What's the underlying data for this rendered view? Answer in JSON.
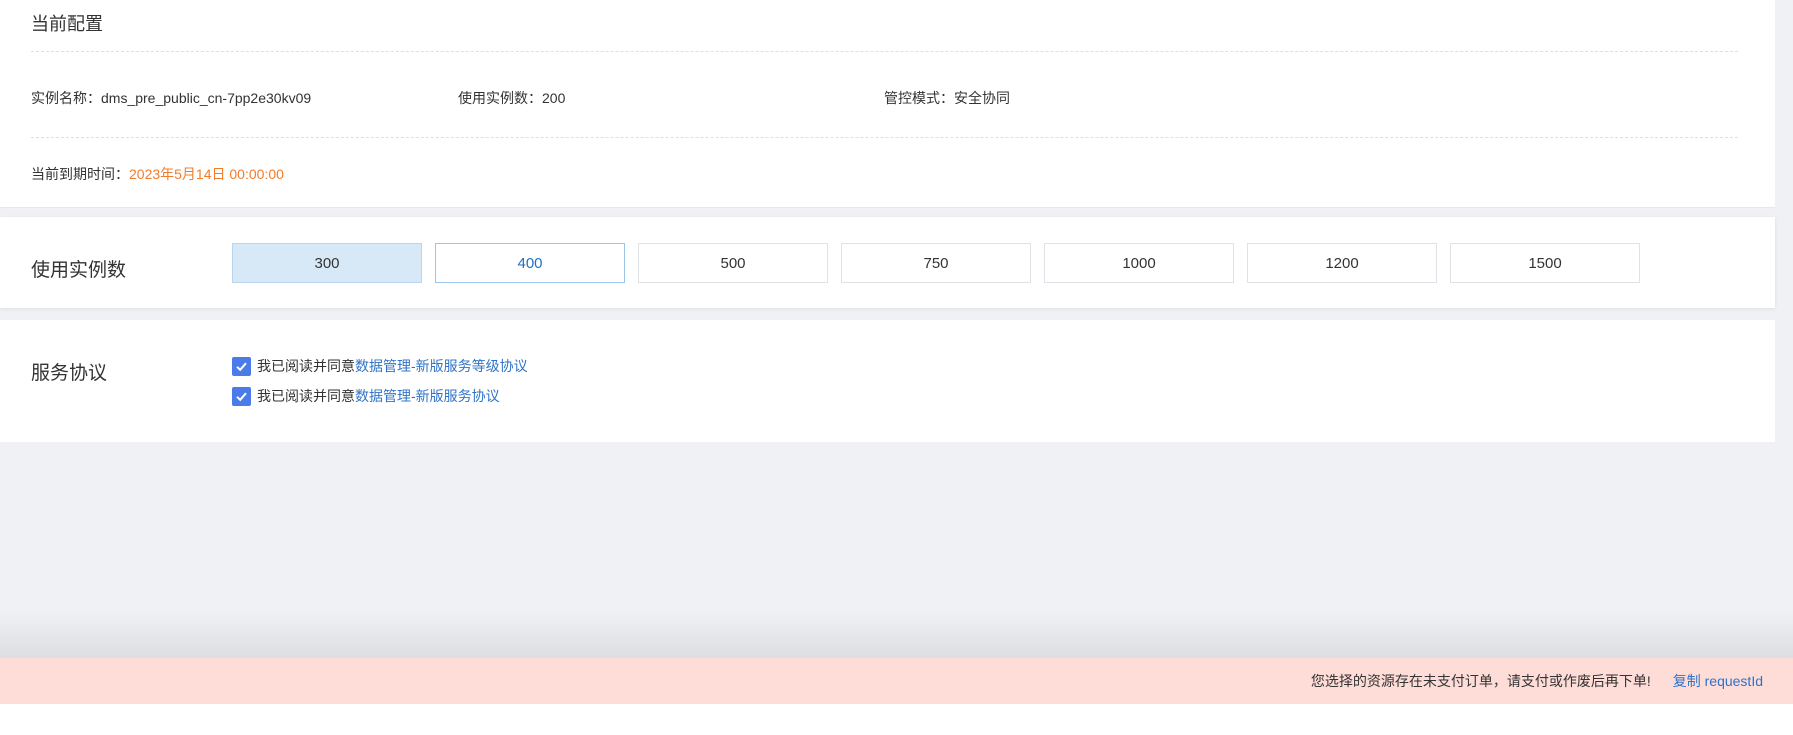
{
  "current_config": {
    "title": "当前配置",
    "instance_name_label": "实例名称：",
    "instance_name_value": "dms_pre_public_cn-7pp2e30kv09",
    "instance_count_label": "使用实例数：",
    "instance_count_value": "200",
    "control_mode_label": "管控模式：",
    "control_mode_value": "安全协同",
    "expire_label": "当前到期时间：",
    "expire_value": "2023年5月14日 00:00:00",
    "expire_color": "#f27c2a"
  },
  "instance_count": {
    "label": "使用实例数",
    "options": [
      "300",
      "400",
      "500",
      "750",
      "1000",
      "1200",
      "1500"
    ],
    "selected": "300",
    "hovered": "400"
  },
  "service_agreement": {
    "label": "服务协议",
    "items": [
      {
        "prefix": "我已阅读并同意",
        "link": "数据管理-新版服务等级协议",
        "checked": true
      },
      {
        "prefix": "我已阅读并同意",
        "link": "数据管理-新版服务协议",
        "checked": true
      }
    ]
  },
  "error_bar": {
    "message": "您选择的资源存在未支付订单，请支付或作废后再下单!",
    "copy_label": "复制 requestId",
    "background": "#fedcd8"
  },
  "icons": {
    "checkbox_checked": "check-icon"
  },
  "colors": {
    "accent": "#4b7be8",
    "link": "#2f73c8",
    "selected_bg": "#d7e9f6"
  }
}
